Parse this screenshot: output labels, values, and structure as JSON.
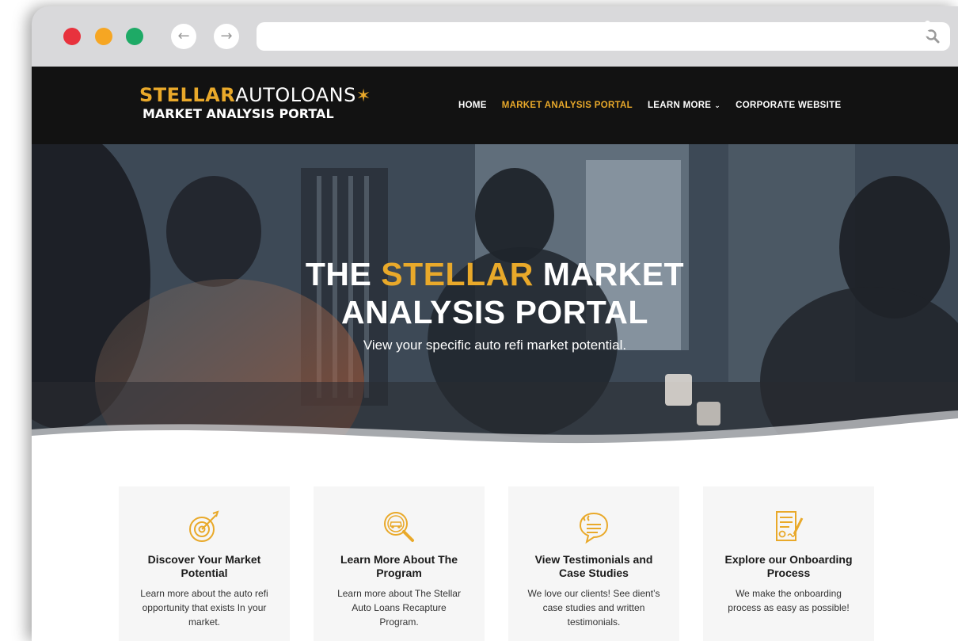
{
  "browser": {
    "traffic_lights": [
      "#e8323d",
      "#f6a623",
      "#1eaa66"
    ],
    "back_icon": "arrow-left-icon",
    "forward_icon": "arrow-right-icon",
    "address_value": "",
    "search_icon": "search-icon",
    "menu_icon": "kebab-menu-icon"
  },
  "header": {
    "logo": {
      "brand_gold": "STELLAR",
      "brand_white": "AUTOLOANS",
      "star": "✶",
      "subtitle": "MARKET ANALYSIS PORTAL"
    },
    "menu": [
      {
        "label": "HOME",
        "active": false
      },
      {
        "label": "MARKET ANALYSIS PORTAL",
        "active": true
      },
      {
        "label": "LEARN MORE",
        "active": false,
        "caret": "⌄"
      },
      {
        "label": "CORPORATE WEBSITE",
        "active": false
      }
    ]
  },
  "hero": {
    "title_part1": "THE ",
    "title_gold": "STELLAR",
    "title_part2": " MARKET",
    "title_line2": "ANALYSIS PORTAL",
    "subtitle": "View your specific auto refi market potential."
  },
  "cards": [
    {
      "icon": "target-icon",
      "title": "Discover Your Market Potential",
      "text": "Learn more about the auto refi opportunity that exists In your market."
    },
    {
      "icon": "magnifier-car-icon",
      "title": "Learn More About The Program",
      "text": "Learn more about The Stellar Auto Loans Recapture Program."
    },
    {
      "icon": "quote-bubble-icon",
      "title": "View Testimonials and Case Studies",
      "text": "We love our clients! See dient’s case studies and written testimonials."
    },
    {
      "icon": "signed-document-icon",
      "title": "Explore our Onboarding Process",
      "text": "We make the onboarding process as easy as possible!"
    }
  ],
  "colors": {
    "accent": "#e9a92a",
    "header_bg": "#121212",
    "card_bg": "#f6f6f6"
  }
}
